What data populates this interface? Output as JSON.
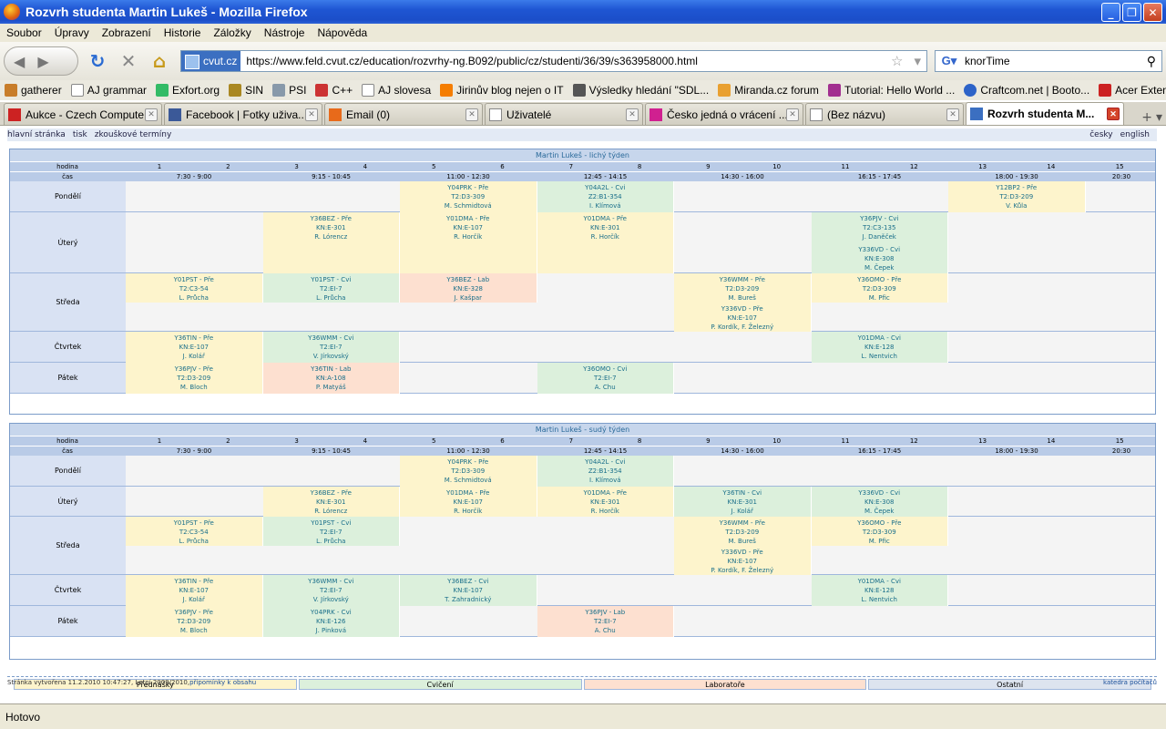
{
  "window": {
    "title": "Rozvrh studenta Martin Lukeš - Mozilla Firefox"
  },
  "menu": [
    "Soubor",
    "Úpravy",
    "Zobrazení",
    "Historie",
    "Záložky",
    "Nástroje",
    "Nápověda"
  ],
  "nav": {
    "site": "cvut.cz",
    "url": "https://www.feld.cvut.cz/education/rozvrhy-ng.B092/public/cz/studenti/36/39/s363958000.html",
    "search_value": "knorTime"
  },
  "bookmarks": [
    "gatherer",
    "AJ grammar",
    "Exfort.org",
    "SIN",
    "PSI",
    "C++",
    "AJ slovesa",
    "Jirinův blog nejen o IT",
    "Výsledky hledání \"SDL...",
    "Miranda.cz forum",
    "Tutorial: Hello World ...",
    "Craftcom.net | Booto...",
    "Acer Extensa 7630EZ-..."
  ],
  "tabs": [
    {
      "label": "Aukce - Czech Compute..."
    },
    {
      "label": "Facebook | Fotky uživa..."
    },
    {
      "label": "Email (0)"
    },
    {
      "label": "Uživatelé"
    },
    {
      "label": "Česko jedná o vrácení ..."
    },
    {
      "label": "(Bez názvu)"
    },
    {
      "label": "Rozvrh studenta M..."
    }
  ],
  "topnav": {
    "home": "hlavní stránka",
    "print": "tisk",
    "exams": "zkouškové termíny",
    "cz": "česky",
    "en": "english"
  },
  "header_labels": {
    "hour": "hodina",
    "time": "čas"
  },
  "hours": [
    "1",
    "2",
    "3",
    "4",
    "5",
    "6",
    "7",
    "8",
    "9",
    "10",
    "11",
    "12",
    "13",
    "14",
    "15"
  ],
  "times": [
    "7:30 - 9:00",
    "9:15 - 10:45",
    "11:00 - 12:30",
    "12:45 - 14:15",
    "14:30 - 16:00",
    "16:15 - 17:45",
    "18:00 - 19:30",
    "20:30"
  ],
  "legend": [
    "Přednášky",
    "Cvičení",
    "Laboratoře",
    "Ostatní"
  ],
  "weeks": [
    {
      "title": "Martin Lukeš - lichý týden",
      "days": [
        "Pondělí",
        "Úterý",
        "Středa",
        "Čtvrtek",
        "Pátek"
      ],
      "cells": [
        {
          "l1": "Y04PRK - Pře",
          "l2": "T2:D3-309",
          "l3": "M. Schmidtová"
        },
        {
          "l1": "Y04A2L - Cvi",
          "l2": "Z2:B1-354",
          "l3": "I. Klímová"
        },
        {
          "l1": "Y12BP2 - Pře",
          "l2": "T2:D3-209",
          "l3": "V. Kůla"
        },
        {
          "l1": "Y36BEZ - Pře",
          "l2": "KN:E-301",
          "l3": "R. Lórencz"
        },
        {
          "l1": "Y01DMA - Pře",
          "l2": "KN:E-107",
          "l3": "R. Horčík"
        },
        {
          "l1": "Y01DMA - Pře",
          "l2": "KN:E-301",
          "l3": "R. Horčík"
        },
        {
          "l1": "Y36PJV - Cvi",
          "l2": "T2:C3-135",
          "l3": "J. Daněček"
        },
        {
          "l1": "Y336VD - Cvi",
          "l2": "KN:E-308",
          "l3": "M. Čepek"
        },
        {
          "l1": "Y01PST - Pře",
          "l2": "T2:C3-54",
          "l3": "L. Průcha"
        },
        {
          "l1": "Y01PST - Cvi",
          "l2": "T2:EI-7",
          "l3": "L. Průcha"
        },
        {
          "l1": "Y36BEZ - Lab",
          "l2": "KN:E-328",
          "l3": "J. Kašpar"
        },
        {
          "l1": "Y36WMM - Pře",
          "l2": "T2:D3-209",
          "l3": "M. Bureš"
        },
        {
          "l1": "Y36OMO - Pře",
          "l2": "T2:D3-309",
          "l3": "M. Pfic"
        },
        {
          "l1": "Y336VD - Pře",
          "l2": "KN:E-107",
          "l3": "P. Kordík, F. Železný"
        },
        {
          "l1": "Y36TIN - Pře",
          "l2": "KN:E-107",
          "l3": "J. Kolář"
        },
        {
          "l1": "Y36WMM - Cvi",
          "l2": "T2:EI-7",
          "l3": "V. Jírkovský"
        },
        {
          "l1": "Y01DMA - Cvi",
          "l2": "KN:E-128",
          "l3": "L. Nentvich"
        },
        {
          "l1": "Y36PJV - Pře",
          "l2": "T2:D3-209",
          "l3": "M. Bloch"
        },
        {
          "l1": "Y36TIN - Lab",
          "l2": "KN:A-108",
          "l3": "P. Matyáš"
        },
        {
          "l1": "Y36OMO - Cvi",
          "l2": "T2:EI-7",
          "l3": "A. Chu"
        }
      ]
    },
    {
      "title": "Martin Lukeš - sudý týden",
      "days": [
        "Pondělí",
        "Úterý",
        "Středa",
        "Čtvrtek",
        "Pátek"
      ],
      "cells": [
        {
          "l1": "Y04PRK - Pře",
          "l2": "T2:D3-309",
          "l3": "M. Schmidtová"
        },
        {
          "l1": "Y04A2L - Cvi",
          "l2": "Z2:B1-354",
          "l3": "I. Klímová"
        },
        {
          "l1": "Y36BEZ - Pře",
          "l2": "KN:E-301",
          "l3": "R. Lórencz"
        },
        {
          "l1": "Y01DMA - Pře",
          "l2": "KN:E-107",
          "l3": "R. Horčík"
        },
        {
          "l1": "Y01DMA - Pře",
          "l2": "KN:E-301",
          "l3": "R. Horčík"
        },
        {
          "l1": "Y36TIN - Cvi",
          "l2": "KN:E-301",
          "l3": "J. Kolář"
        },
        {
          "l1": "Y336VD - Cvi",
          "l2": "KN:E-308",
          "l3": "M. Čepek"
        },
        {
          "l1": "Y01PST - Pře",
          "l2": "T2:C3-54",
          "l3": "L. Průcha"
        },
        {
          "l1": "Y01PST - Cvi",
          "l2": "T2:EI-7",
          "l3": "L. Průcha"
        },
        {
          "l1": "Y36WMM - Pře",
          "l2": "T2:D3-209",
          "l3": "M. Bureš"
        },
        {
          "l1": "Y36OMO - Pře",
          "l2": "T2:D3-309",
          "l3": "M. Pfic"
        },
        {
          "l1": "Y336VD - Pře",
          "l2": "KN:E-107",
          "l3": "P. Kordík, F. Železný"
        },
        {
          "l1": "Y36TIN - Pře",
          "l2": "KN:E-107",
          "l3": "J. Kolář"
        },
        {
          "l1": "Y36WMM - Cvi",
          "l2": "T2:EI-7",
          "l3": "V. Jírkovský"
        },
        {
          "l1": "Y36BEZ - Cvi",
          "l2": "KN:E-107",
          "l3": "T. Zahradnický"
        },
        {
          "l1": "Y01DMA - Cvi",
          "l2": "KN:E-128",
          "l3": "L. Nentvich"
        },
        {
          "l1": "Y36PJV - Pře",
          "l2": "T2:D3-209",
          "l3": "M. Bloch"
        },
        {
          "l1": "Y04PRK - Cvi",
          "l2": "KN:E-126",
          "l3": "J. Pinková"
        },
        {
          "l1": "Y36PJV - Lab",
          "l2": "T2:EI-7",
          "l3": "A. Chu"
        }
      ]
    }
  ],
  "footer": {
    "left": "Stránka vytvořena 11.2.2010 10:47:27, Letní 2009/2010, ",
    "link": "připomínky k obsahu",
    "right": "katedra počítačů"
  },
  "status": "Hotovo"
}
